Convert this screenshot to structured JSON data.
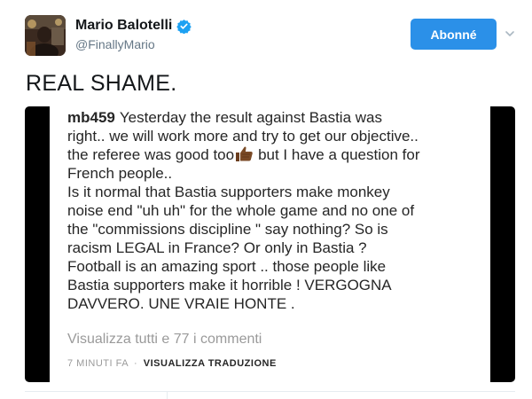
{
  "profile": {
    "name": "Mario Balotelli",
    "handle": "@FinallyMario",
    "verified": true,
    "verified_color": "#1da1f2"
  },
  "follow_button": {
    "label": "Abonné",
    "color": "#2b90e8"
  },
  "tweet": {
    "text": "REAL SHAME."
  },
  "embedded_post": {
    "username": "mb459",
    "caption_lines": [
      "Yesterday the result against Bastia was",
      "right.. we will work more and try to get our objective..",
      "the referee was good too",
      "but I have a question for",
      "French people..",
      "Is it normal that Bastia supporters make monkey",
      "noise end \"uh uh\" for the whole game and no one of",
      "the \"commissions discipline \" say  nothing? So is",
      "racism LEGAL in France? Or only in Bastia ?",
      "Football is an amazing sport .. those people like",
      "Bastia supporters make it horrible ! VERGOGNA",
      "DAVVERO. UNE VRAIE HONTE ."
    ],
    "emoji": "thumbs-up-icon",
    "view_comments": "Visualizza tutti e 77 i commenti",
    "time": "7 MINUTI FA",
    "separator": "·",
    "translate": "VISUALIZZA TRADUZIONE"
  }
}
